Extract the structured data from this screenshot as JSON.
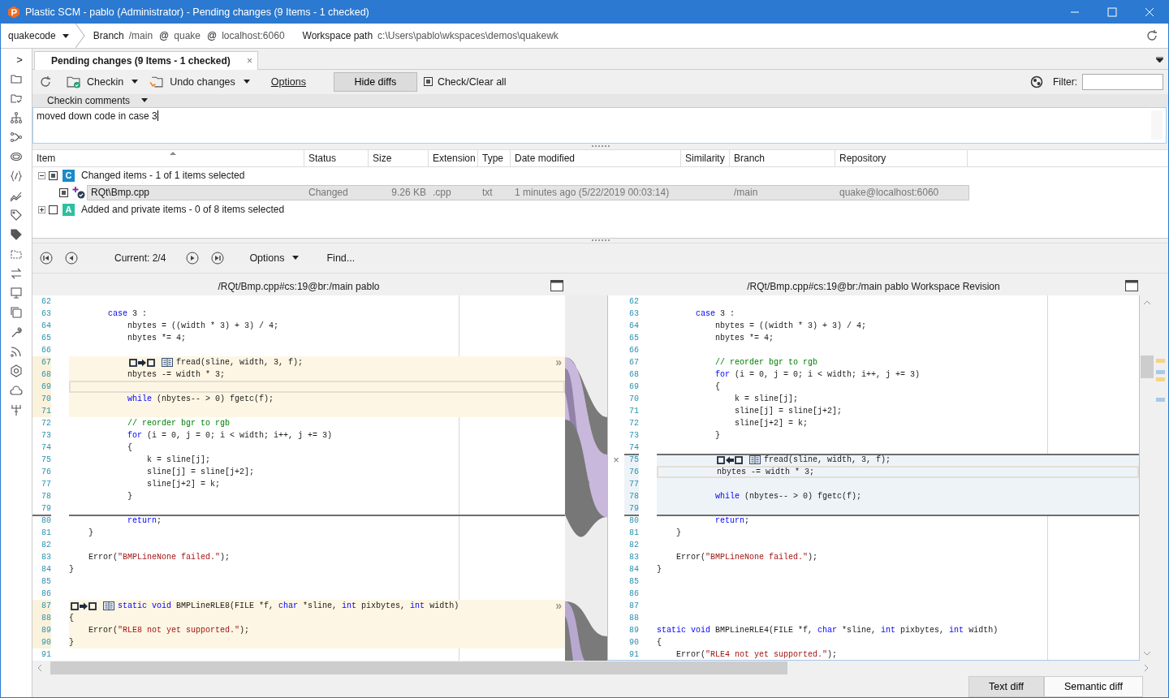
{
  "window": {
    "title": "Plastic SCM - pablo (Administrator) - Pending changes (9 Items - 1 checked)"
  },
  "workspace_bar": {
    "repository": "quakecode",
    "branch_label": "Branch",
    "branch": "/main",
    "at_1": "@",
    "repo": "quake",
    "at_2": "@",
    "server": "localhost:6060",
    "path_label": "Workspace path",
    "path": "c:\\Users\\pablo\\wkspaces\\demos\\quakewk"
  },
  "sidebar": {
    "expand": ">"
  },
  "tabs": [
    {
      "label": "Pending changes (9 Items - 1 checked)",
      "selected": true,
      "close": "×"
    }
  ],
  "toolbar": {
    "checkin": "Checkin",
    "undo": "Undo changes",
    "options": "Options",
    "hide_diffs": {
      "label": "Hide diffs",
      "pressed": true
    },
    "check_all": {
      "label": "Check/Clear all",
      "checked": true
    },
    "filter_label": "Filter:"
  },
  "comments": {
    "header": "Checkin comments",
    "text": "moved down code in case 3"
  },
  "changes": {
    "columns": [
      "Item",
      "Status",
      "Size",
      "Extension",
      "Type",
      "Date modified",
      "Similarity",
      "Branch",
      "Repository"
    ],
    "groups": [
      {
        "badge": "C",
        "color": "#1b8ac9",
        "label": "Changed items - 1 of 1 items selected",
        "expanded": true,
        "checked": true,
        "children": [
          {
            "item": "RQt\\Bmp.cpp",
            "status": "Changed",
            "size": "9.26 KB",
            "extension": ".cpp",
            "type": "txt",
            "date_modified": "1 minutes ago (5/22/2019 00:03:14)",
            "branch": "/main",
            "repository": "quake@localhost:6060",
            "checked": true,
            "selected": true
          }
        ]
      },
      {
        "badge": "A",
        "color": "#2cc0a0",
        "label": "Added and private items - 0 of 8 items selected",
        "expanded": false,
        "checked": false
      }
    ]
  },
  "diff_nav": {
    "current": "Current: 2/4",
    "options": "Options",
    "find": "Find..."
  },
  "panes": [
    {
      "title": "/RQt/Bmp.cpp#cs:19@br:/main pablo",
      "focused": false,
      "lines": [
        {
          "n": "62"
        },
        {
          "n": "63",
          "t": [
            {
              "text": "        case",
              "kind": "keyword"
            },
            {
              "text": " 3 :"
            }
          ]
        },
        {
          "n": "64",
          "t": [
            {
              "text": "            nbytes = ((width * 3) + 3) / 4;"
            }
          ]
        },
        {
          "n": "65",
          "t": [
            {
              "text": "            nbytes *= 4;"
            }
          ]
        },
        {
          "n": "66"
        },
        {
          "n": "67",
          "t": [
            {
              "text": "            fread(sline, width, 3, f);"
            }
          ],
          "moved_out": true,
          "move_button": true,
          "jump": "»"
        },
        {
          "n": "68",
          "t": [
            {
              "text": "            nbytes -= width * 3;"
            }
          ],
          "moved_out": true
        },
        {
          "n": "69",
          "moved_out": true,
          "boxed": true
        },
        {
          "n": "70",
          "t": [
            {
              "text": "            while",
              "kind": "keyword"
            },
            {
              "text": " (nbytes-- > 0) fgetc(f);"
            }
          ],
          "moved_out": true
        },
        {
          "n": "71",
          "moved_out": true
        },
        {
          "n": "72",
          "t": [
            {
              "text": "            // reorder bgr to rgb",
              "kind": "comment"
            }
          ]
        },
        {
          "n": "73",
          "t": [
            {
              "text": "            for",
              "kind": "keyword"
            },
            {
              "text": " (i = 0, j = 0; i < width; i++, j += 3)"
            }
          ]
        },
        {
          "n": "74",
          "t": [
            {
              "text": "            {"
            }
          ]
        },
        {
          "n": "75",
          "t": [
            {
              "text": "                k = sline[j];"
            }
          ]
        },
        {
          "n": "76",
          "t": [
            {
              "text": "                sline[j] = sline[j+2];"
            }
          ]
        },
        {
          "n": "77",
          "t": [
            {
              "text": "                sline[j+2] = k;"
            }
          ]
        },
        {
          "n": "78",
          "t": [
            {
              "text": "            }"
            }
          ]
        },
        {
          "n": "79"
        },
        {
          "n": "80",
          "t": [
            {
              "text": "            return",
              "kind": "keyword"
            },
            {
              "text": ";"
            }
          ],
          "rule": true
        },
        {
          "n": "81",
          "t": [
            {
              "text": "    }"
            }
          ]
        },
        {
          "n": "82"
        },
        {
          "n": "83",
          "t": [
            {
              "text": "    Error("
            },
            {
              "text": "\"BMPLineNone failed.\"",
              "kind": "string"
            },
            {
              "text": ");"
            }
          ]
        },
        {
          "n": "84",
          "t": [
            {
              "text": "}"
            }
          ]
        },
        {
          "n": "85"
        },
        {
          "n": "86"
        },
        {
          "n": "87",
          "t": [
            {
              "text": "static void",
              "kind": "keyword"
            },
            {
              "text": " BMPLineRLE8(FILE *f, "
            },
            {
              "text": "char",
              "kind": "keyword"
            },
            {
              "text": " *sline, "
            },
            {
              "text": "int",
              "kind": "keyword"
            },
            {
              "text": " pixbytes, "
            },
            {
              "text": "int",
              "kind": "keyword"
            },
            {
              "text": " width)"
            }
          ],
          "moved_out": true,
          "move_button": true,
          "jump": "»"
        },
        {
          "n": "88",
          "t": [
            {
              "text": "{"
            }
          ],
          "moved_out": true
        },
        {
          "n": "89",
          "t": [
            {
              "text": "    Error("
            },
            {
              "text": "\"RLE8 not yet supported.\"",
              "kind": "string"
            },
            {
              "text": ");"
            }
          ],
          "moved_out": true
        },
        {
          "n": "90",
          "t": [
            {
              "text": "}"
            }
          ],
          "moved_out": true
        },
        {
          "n": "91"
        }
      ]
    },
    {
      "title": "/RQt/Bmp.cpp#cs:19@br:/main pablo Workspace Revision",
      "focused": true,
      "lines": [
        {
          "n": "62"
        },
        {
          "n": "63",
          "t": [
            {
              "text": "        case",
              "kind": "keyword"
            },
            {
              "text": " 3 :"
            }
          ]
        },
        {
          "n": "64",
          "t": [
            {
              "text": "            nbytes = ((width * 3) + 3) / 4;"
            }
          ]
        },
        {
          "n": "65",
          "t": [
            {
              "text": "            nbytes *= 4;"
            }
          ]
        },
        {
          "n": "66"
        },
        {
          "n": "67",
          "t": [
            {
              "text": "            // reorder bgr to rgb",
              "kind": "comment"
            }
          ]
        },
        {
          "n": "68",
          "t": [
            {
              "text": "            for",
              "kind": "keyword"
            },
            {
              "text": " (i = 0, j = 0; i < width; i++, j += 3)"
            }
          ]
        },
        {
          "n": "69",
          "t": [
            {
              "text": "            {"
            }
          ]
        },
        {
          "n": "70",
          "t": [
            {
              "text": "                k = sline[j];"
            }
          ]
        },
        {
          "n": "71",
          "t": [
            {
              "text": "                sline[j] = sline[j+2];"
            }
          ]
        },
        {
          "n": "72",
          "t": [
            {
              "text": "                sline[j+2] = k;"
            }
          ]
        },
        {
          "n": "73",
          "t": [
            {
              "text": "            }"
            }
          ]
        },
        {
          "n": "74"
        },
        {
          "n": "75",
          "t": [
            {
              "text": "            fread(sline, width, 3, f);"
            }
          ],
          "moved_in": true,
          "move_button": true,
          "rule": true,
          "gutter": "×"
        },
        {
          "n": "76",
          "t": [
            {
              "text": "            nbytes -= width * 3;"
            }
          ],
          "moved_in": true,
          "boxed": true
        },
        {
          "n": "77",
          "moved_in": true
        },
        {
          "n": "78",
          "t": [
            {
              "text": "            while",
              "kind": "keyword"
            },
            {
              "text": " (nbytes-- > 0) fgetc(f);"
            }
          ],
          "moved_in": true
        },
        {
          "n": "79",
          "moved_in": true
        },
        {
          "n": "80",
          "t": [
            {
              "text": "            return",
              "kind": "keyword"
            },
            {
              "text": ";"
            }
          ],
          "rule": true
        },
        {
          "n": "81",
          "t": [
            {
              "text": "    }"
            }
          ]
        },
        {
          "n": "82"
        },
        {
          "n": "83",
          "t": [
            {
              "text": "    Error("
            },
            {
              "text": "\"BMPLineNone failed.\"",
              "kind": "string"
            },
            {
              "text": ");"
            }
          ]
        },
        {
          "n": "84",
          "t": [
            {
              "text": "}"
            }
          ]
        },
        {
          "n": "85"
        },
        {
          "n": "86"
        },
        {
          "n": "87"
        },
        {
          "n": "88"
        },
        {
          "n": "89",
          "t": [
            {
              "text": "static void",
              "kind": "keyword"
            },
            {
              "text": " BMPLineRLE4(FILE *f, "
            },
            {
              "text": "char",
              "kind": "keyword"
            },
            {
              "text": " *sline, "
            },
            {
              "text": "int",
              "kind": "keyword"
            },
            {
              "text": " pixbytes, "
            },
            {
              "text": "int",
              "kind": "keyword"
            },
            {
              "text": " width)"
            }
          ]
        },
        {
          "n": "90",
          "t": [
            {
              "text": "{"
            }
          ]
        },
        {
          "n": "91",
          "t": [
            {
              "text": "    Error("
            },
            {
              "text": "\"RLE4 not yet supported.\"",
              "kind": "string"
            },
            {
              "text": ");"
            }
          ]
        }
      ]
    }
  ],
  "view_modes": [
    {
      "label": "Text diff",
      "selected": true
    },
    {
      "label": "Semantic diff",
      "selected": false
    }
  ]
}
